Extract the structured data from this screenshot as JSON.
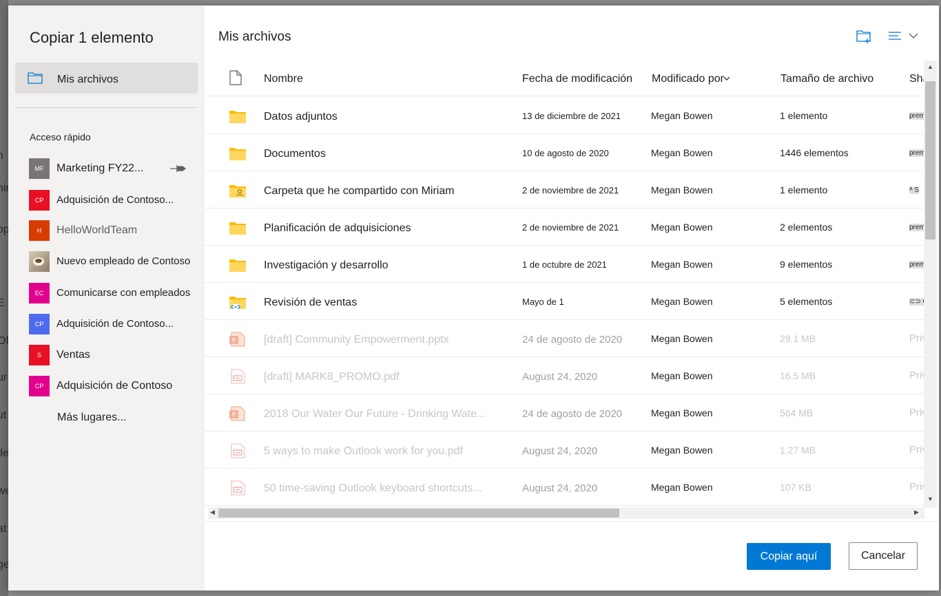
{
  "background_fragments": [
    "h",
    "nin",
    "op",
    "E",
    "ON",
    "ur",
    "ut",
    "tle",
    "we",
    "at",
    "ge"
  ],
  "dialog": {
    "title": "Copiar 1 elemento",
    "my_files_label": "Mis archivos",
    "quick_access_title": "Acceso rápido",
    "quick_access": [
      {
        "initials": "MF",
        "label": "Marketing FY22...",
        "color": "#7a7574",
        "pinned": true
      },
      {
        "initials": "CP",
        "label": "Adquisición de Contoso...",
        "color": "#e81123"
      },
      {
        "initials": "H",
        "label": "HelloWorldTeam",
        "color": "#d83b01"
      },
      {
        "initials": "",
        "label": "Nuevo empleado de Contoso",
        "color": "#c8b8a0"
      },
      {
        "initials": "EC",
        "label": "Comunicarse con empleados",
        "color": "#e3008c"
      },
      {
        "initials": "CP",
        "label": "Adquisición de Contoso...",
        "color": "#4f6bed"
      },
      {
        "initials": "S",
        "label": "Ventas",
        "color": "#e81123"
      },
      {
        "initials": "CP",
        "label": "Adquisición de Contoso",
        "color": "#e3008c"
      }
    ],
    "more_places": "Más lugares...",
    "pane_title": "Mis archivos",
    "columns": {
      "name": "Nombre",
      "modified": "Fecha de modificación",
      "modified_by": "Modificado por",
      "size": "Tamaño de archivo",
      "sharing": "Sha"
    },
    "rows": [
      {
        "type": "folder",
        "name": "Datos adjuntos",
        "date": "13 de diciembre de 2021",
        "by": "Megan Bowen",
        "size": "1 elemento",
        "share": "premio"
      },
      {
        "type": "folder",
        "name": "Documentos",
        "date": "10 de agosto de 2020",
        "by": "Megan Bowen",
        "size": "1446 elementos",
        "share": "premio"
      },
      {
        "type": "folder-shared",
        "name": "Carpeta que he compartido con Miriam",
        "date": "2 de noviembre de 2021",
        "by": "Megan Bowen",
        "size": "1 elemento",
        "share": "ᴬ S"
      },
      {
        "type": "folder",
        "name": "Planificación de adquisiciones",
        "date": "2 de noviembre de 2021",
        "by": "Megan Bowen",
        "size": "2 elementos",
        "share": "premio"
      },
      {
        "type": "folder",
        "name": "Investigación y desarrollo",
        "date": "1 de octubre de 2021",
        "by": "Megan Bowen",
        "size": "9 elementos",
        "share": "premio"
      },
      {
        "type": "folder-link",
        "name": "Revisión de ventas",
        "date": "Mayo de 1",
        "by": "Megan Bowen",
        "size": "5 elementos",
        "share": "⊂⊃ C"
      },
      {
        "type": "pptx",
        "name": "[draft] Community Empowerment.pptx",
        "date": "24 de agosto de 2020",
        "by": "Megan Bowen",
        "size": "29.1 MB",
        "share": "Priv"
      },
      {
        "type": "pdf",
        "name": "[draft] MARK8_PROMO.pdf",
        "date": "August 24, 2020",
        "by": "Megan Bowen",
        "size": "16.5 MB",
        "share": "Priv"
      },
      {
        "type": "pptx",
        "name": "2018 Our Water Our Future - Drinking Wate...",
        "date": "24 de agosto de 2020",
        "by": "Megan Bowen",
        "size": "564 MB",
        "share": "Priv"
      },
      {
        "type": "pdf",
        "name": "5 ways to make Outlook work for you.pdf",
        "date": "August 24, 2020",
        "by": "Megan Bowen",
        "size": "1.27 MB",
        "share": "Priv"
      },
      {
        "type": "pdf",
        "name": "50 time-saving Outlook keyboard shortcuts...",
        "date": "August 24, 2020",
        "by": "Megan Bowen",
        "size": "107 KB",
        "share": "Priv"
      }
    ],
    "copy_button": "Copiar aquí",
    "cancel_button": "Cancelar"
  }
}
